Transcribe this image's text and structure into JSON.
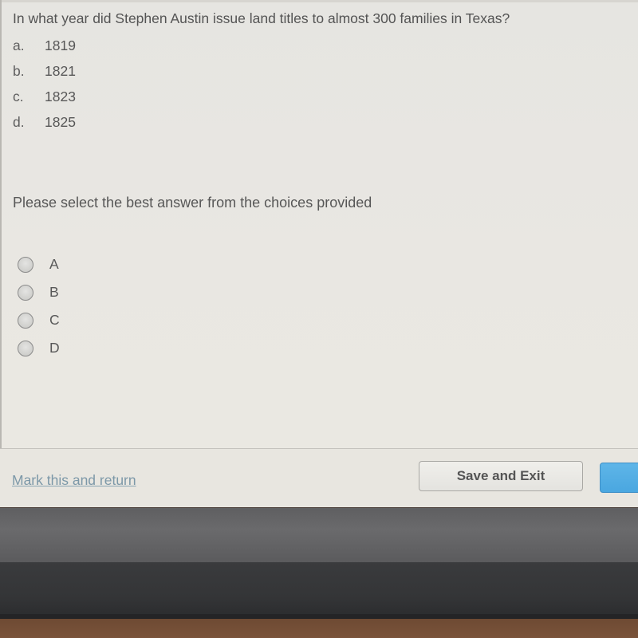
{
  "question": {
    "text": "In what year did Stephen Austin issue land titles to almost 300 families in Texas?",
    "choices": [
      {
        "letter": "a.",
        "value": "1819"
      },
      {
        "letter": "b.",
        "value": "1821"
      },
      {
        "letter": "c.",
        "value": "1823"
      },
      {
        "letter": "d.",
        "value": "1825"
      }
    ]
  },
  "instruction": "Please select the best answer from the choices provided",
  "answers": [
    {
      "label": "A",
      "selected": false
    },
    {
      "label": "B",
      "selected": false
    },
    {
      "label": "C",
      "selected": false
    },
    {
      "label": "D",
      "selected": false
    }
  ],
  "footer": {
    "mark_link": "Mark this and return",
    "save_button": "Save and Exit",
    "next_button": ""
  },
  "colors": {
    "link": "#7c98a8",
    "primary_button": "#4aa7e0"
  }
}
